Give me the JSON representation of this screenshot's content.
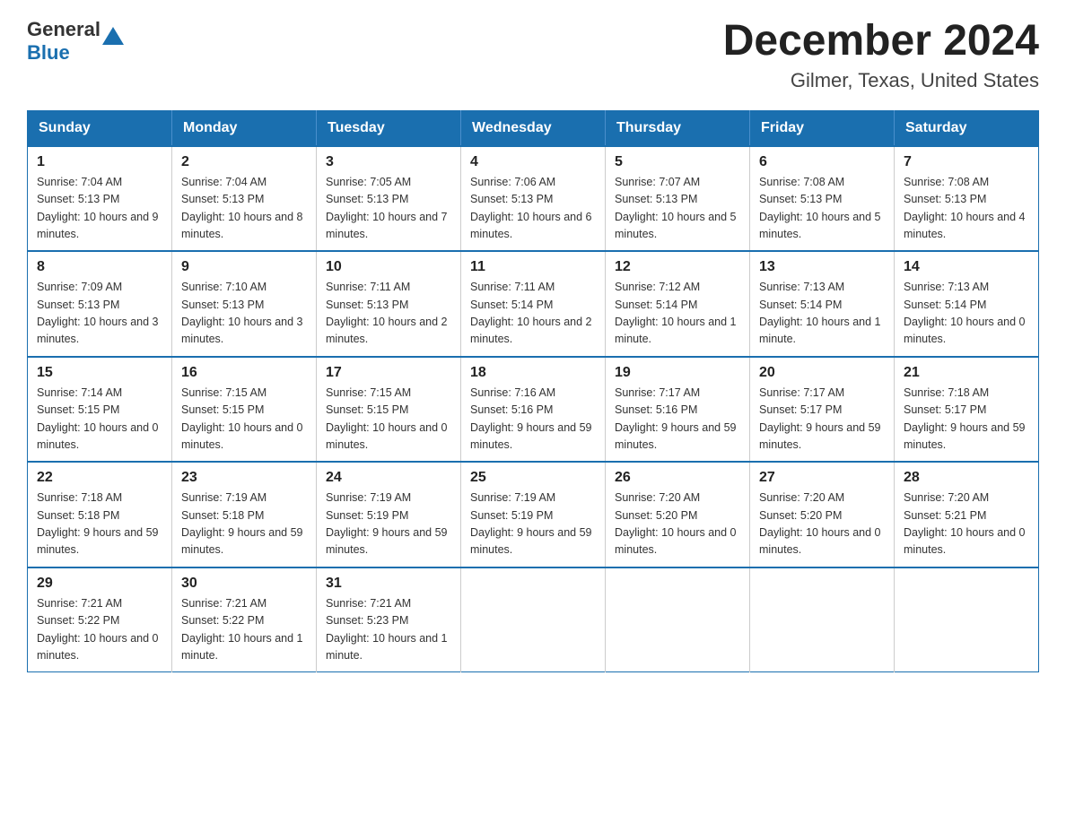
{
  "header": {
    "logo_general": "General",
    "logo_blue": "Blue",
    "title": "December 2024",
    "subtitle": "Gilmer, Texas, United States"
  },
  "days_of_week": [
    "Sunday",
    "Monday",
    "Tuesday",
    "Wednesday",
    "Thursday",
    "Friday",
    "Saturday"
  ],
  "weeks": [
    [
      {
        "day": "1",
        "sunrise": "7:04 AM",
        "sunset": "5:13 PM",
        "daylight": "10 hours and 9 minutes."
      },
      {
        "day": "2",
        "sunrise": "7:04 AM",
        "sunset": "5:13 PM",
        "daylight": "10 hours and 8 minutes."
      },
      {
        "day": "3",
        "sunrise": "7:05 AM",
        "sunset": "5:13 PM",
        "daylight": "10 hours and 7 minutes."
      },
      {
        "day": "4",
        "sunrise": "7:06 AM",
        "sunset": "5:13 PM",
        "daylight": "10 hours and 6 minutes."
      },
      {
        "day": "5",
        "sunrise": "7:07 AM",
        "sunset": "5:13 PM",
        "daylight": "10 hours and 5 minutes."
      },
      {
        "day": "6",
        "sunrise": "7:08 AM",
        "sunset": "5:13 PM",
        "daylight": "10 hours and 5 minutes."
      },
      {
        "day": "7",
        "sunrise": "7:08 AM",
        "sunset": "5:13 PM",
        "daylight": "10 hours and 4 minutes."
      }
    ],
    [
      {
        "day": "8",
        "sunrise": "7:09 AM",
        "sunset": "5:13 PM",
        "daylight": "10 hours and 3 minutes."
      },
      {
        "day": "9",
        "sunrise": "7:10 AM",
        "sunset": "5:13 PM",
        "daylight": "10 hours and 3 minutes."
      },
      {
        "day": "10",
        "sunrise": "7:11 AM",
        "sunset": "5:13 PM",
        "daylight": "10 hours and 2 minutes."
      },
      {
        "day": "11",
        "sunrise": "7:11 AM",
        "sunset": "5:14 PM",
        "daylight": "10 hours and 2 minutes."
      },
      {
        "day": "12",
        "sunrise": "7:12 AM",
        "sunset": "5:14 PM",
        "daylight": "10 hours and 1 minute."
      },
      {
        "day": "13",
        "sunrise": "7:13 AM",
        "sunset": "5:14 PM",
        "daylight": "10 hours and 1 minute."
      },
      {
        "day": "14",
        "sunrise": "7:13 AM",
        "sunset": "5:14 PM",
        "daylight": "10 hours and 0 minutes."
      }
    ],
    [
      {
        "day": "15",
        "sunrise": "7:14 AM",
        "sunset": "5:15 PM",
        "daylight": "10 hours and 0 minutes."
      },
      {
        "day": "16",
        "sunrise": "7:15 AM",
        "sunset": "5:15 PM",
        "daylight": "10 hours and 0 minutes."
      },
      {
        "day": "17",
        "sunrise": "7:15 AM",
        "sunset": "5:15 PM",
        "daylight": "10 hours and 0 minutes."
      },
      {
        "day": "18",
        "sunrise": "7:16 AM",
        "sunset": "5:16 PM",
        "daylight": "9 hours and 59 minutes."
      },
      {
        "day": "19",
        "sunrise": "7:17 AM",
        "sunset": "5:16 PM",
        "daylight": "9 hours and 59 minutes."
      },
      {
        "day": "20",
        "sunrise": "7:17 AM",
        "sunset": "5:17 PM",
        "daylight": "9 hours and 59 minutes."
      },
      {
        "day": "21",
        "sunrise": "7:18 AM",
        "sunset": "5:17 PM",
        "daylight": "9 hours and 59 minutes."
      }
    ],
    [
      {
        "day": "22",
        "sunrise": "7:18 AM",
        "sunset": "5:18 PM",
        "daylight": "9 hours and 59 minutes."
      },
      {
        "day": "23",
        "sunrise": "7:19 AM",
        "sunset": "5:18 PM",
        "daylight": "9 hours and 59 minutes."
      },
      {
        "day": "24",
        "sunrise": "7:19 AM",
        "sunset": "5:19 PM",
        "daylight": "9 hours and 59 minutes."
      },
      {
        "day": "25",
        "sunrise": "7:19 AM",
        "sunset": "5:19 PM",
        "daylight": "9 hours and 59 minutes."
      },
      {
        "day": "26",
        "sunrise": "7:20 AM",
        "sunset": "5:20 PM",
        "daylight": "10 hours and 0 minutes."
      },
      {
        "day": "27",
        "sunrise": "7:20 AM",
        "sunset": "5:20 PM",
        "daylight": "10 hours and 0 minutes."
      },
      {
        "day": "28",
        "sunrise": "7:20 AM",
        "sunset": "5:21 PM",
        "daylight": "10 hours and 0 minutes."
      }
    ],
    [
      {
        "day": "29",
        "sunrise": "7:21 AM",
        "sunset": "5:22 PM",
        "daylight": "10 hours and 0 minutes."
      },
      {
        "day": "30",
        "sunrise": "7:21 AM",
        "sunset": "5:22 PM",
        "daylight": "10 hours and 1 minute."
      },
      {
        "day": "31",
        "sunrise": "7:21 AM",
        "sunset": "5:23 PM",
        "daylight": "10 hours and 1 minute."
      },
      null,
      null,
      null,
      null
    ]
  ],
  "labels": {
    "sunrise": "Sunrise:",
    "sunset": "Sunset:",
    "daylight": "Daylight:"
  }
}
